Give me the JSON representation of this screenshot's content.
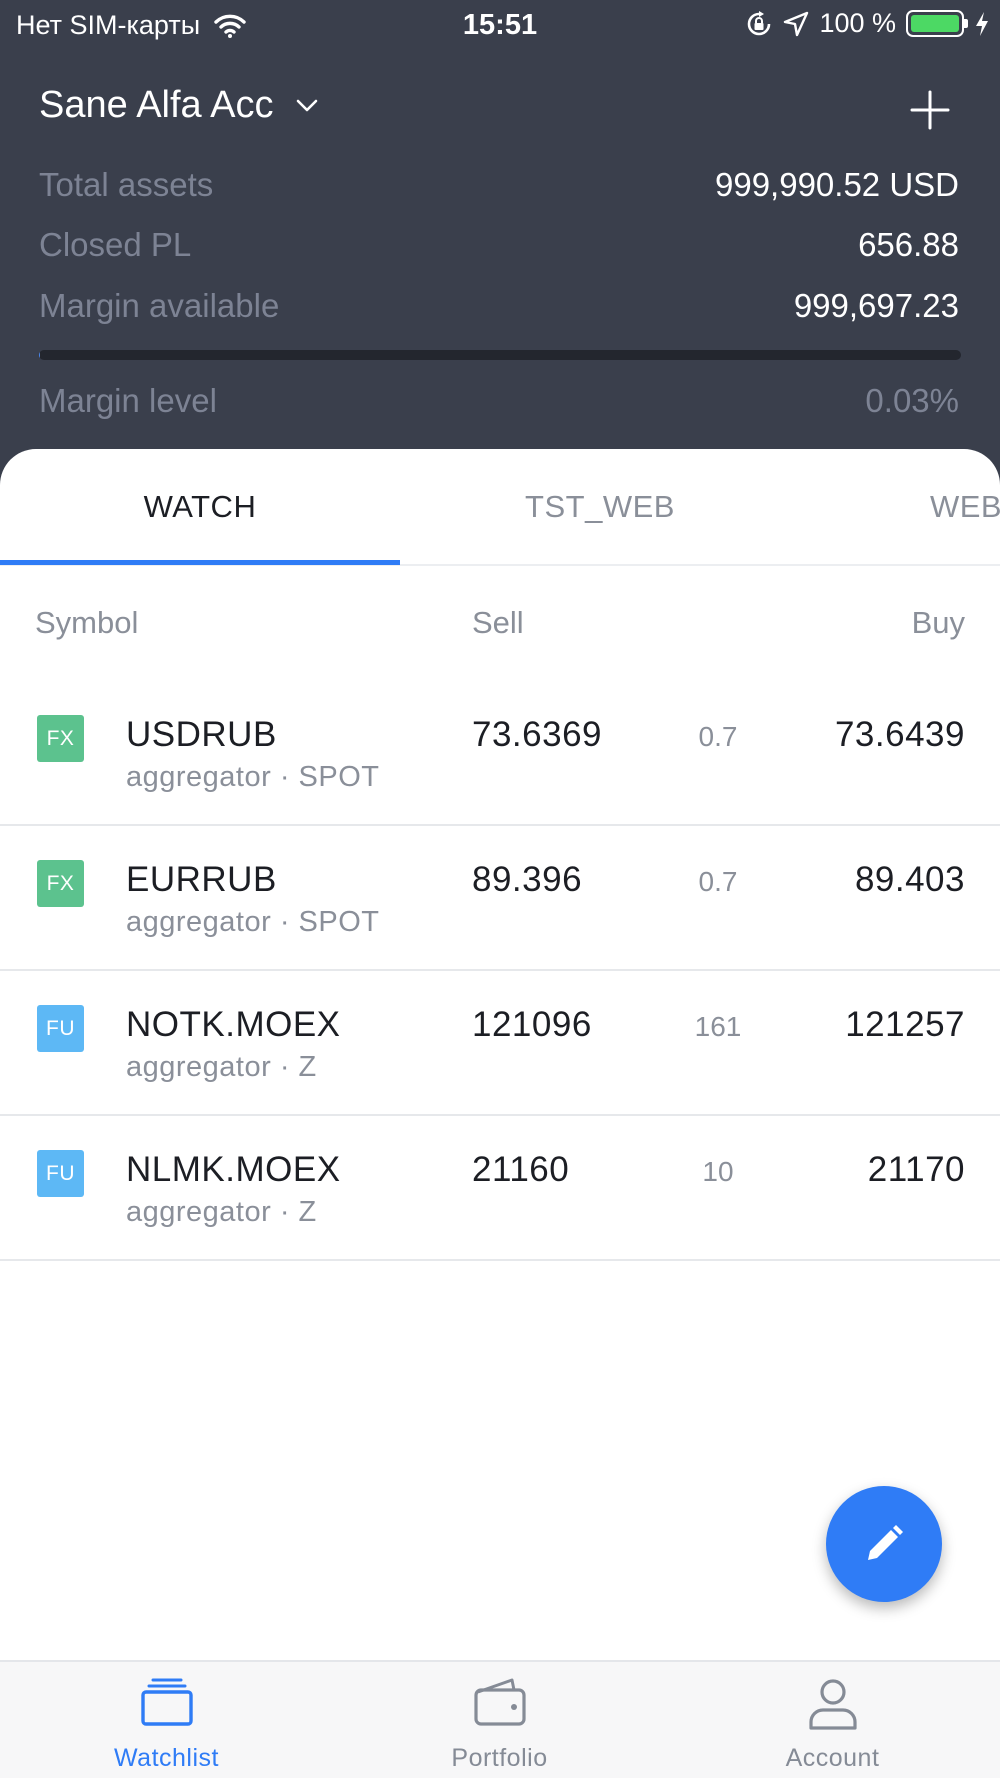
{
  "status_bar": {
    "carrier": "Нет SIM-карты",
    "time": "15:51",
    "battery": "100 %",
    "battery_level": 1.0,
    "icons": [
      "wifi-icon",
      "rotation-lock-icon",
      "location-arrow-icon",
      "battery-icon",
      "charging-bolt-icon"
    ]
  },
  "account": {
    "name": "Sane Alfa Acc",
    "add_icon": "plus-icon",
    "dropdown_icon": "chevron-down-icon",
    "stats": [
      {
        "label": "Total assets",
        "value": "999,990.52 USD"
      },
      {
        "label": "Closed PL",
        "value": "656.88"
      },
      {
        "label": "Margin available",
        "value": "999,697.23"
      }
    ],
    "margin_level": {
      "label": "Margin level",
      "value": "0.03%",
      "fraction": 0.0003
    }
  },
  "tabs": [
    {
      "label": "WATCH",
      "active": true
    },
    {
      "label": "TST_WEB",
      "active": false
    },
    {
      "label": "WEB",
      "active": false
    }
  ],
  "columns": {
    "symbol": "Symbol",
    "sell": "Sell",
    "buy": "Buy"
  },
  "rows": [
    {
      "badge": "FX",
      "symbol": "USDRUB",
      "sub": "aggregator · SPOT",
      "sell": "73.6369",
      "spread": "0.7",
      "buy": "73.6439"
    },
    {
      "badge": "FX",
      "symbol": "EURRUB",
      "sub": "aggregator · SPOT",
      "sell": "89.396",
      "spread": "0.7",
      "buy": "89.403"
    },
    {
      "badge": "FU",
      "symbol": "NOTK.MOEX",
      "sub": "aggregator · Z",
      "sell": "121096",
      "spread": "161",
      "buy": "121257"
    },
    {
      "badge": "FU",
      "symbol": "NLMK.MOEX",
      "sub": "aggregator · Z",
      "sell": "21160",
      "spread": "10",
      "buy": "21170"
    }
  ],
  "badge_colors": {
    "FX": "#5cc28e",
    "FU": "#5db8f5"
  },
  "fab_icon": "pencil-icon",
  "nav": [
    {
      "label": "Watchlist",
      "icon": "watchlist-icon",
      "active": true
    },
    {
      "label": "Portfolio",
      "icon": "wallet-icon",
      "active": false
    },
    {
      "label": "Account",
      "icon": "person-icon",
      "active": false
    }
  ],
  "colors": {
    "header_bg": "#3a3f4c",
    "accent": "#2f7cf6",
    "muted": "#8a8f99"
  }
}
